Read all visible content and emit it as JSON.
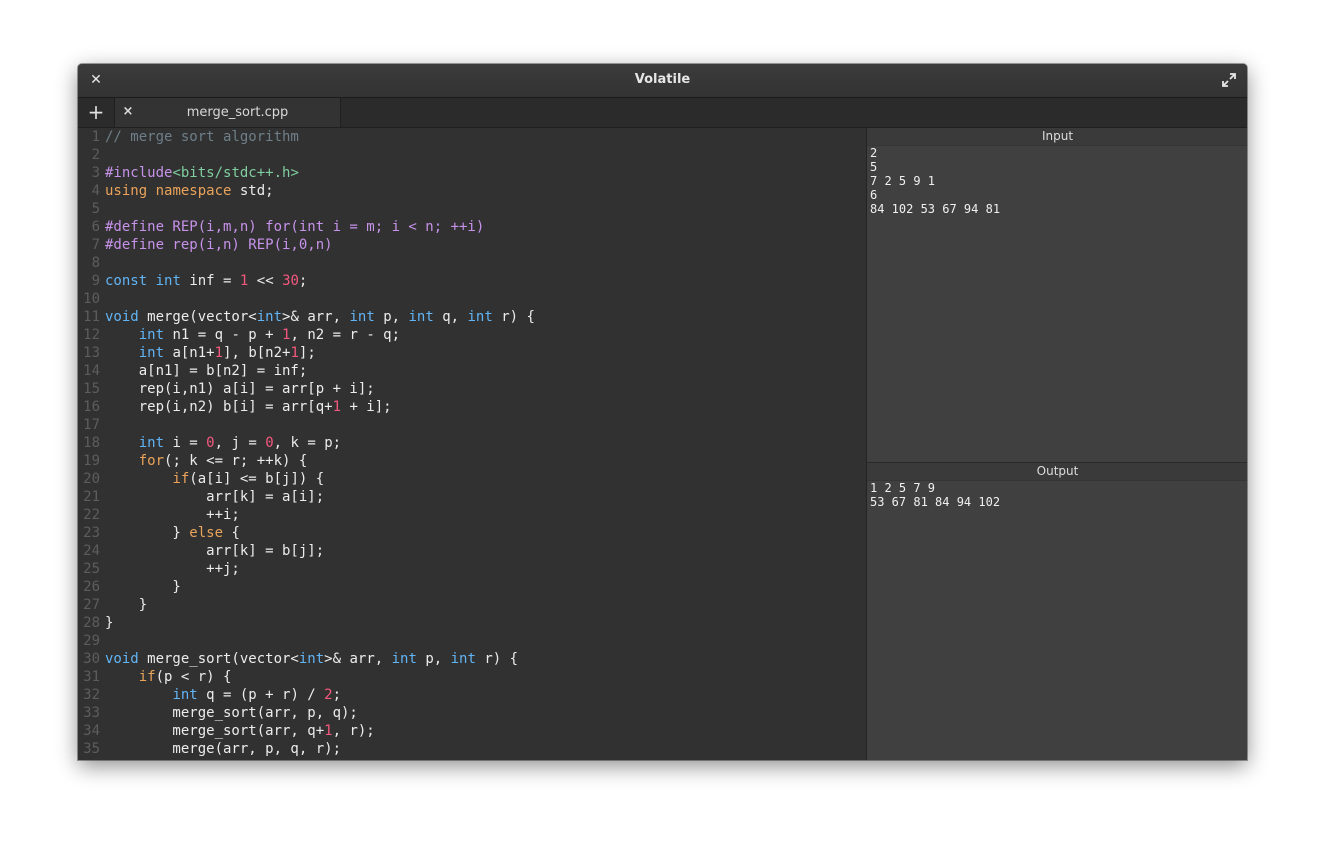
{
  "window": {
    "title": "Volatile"
  },
  "tabbar": {
    "new_tab_symbol": "+",
    "tabs": [
      {
        "label": "merge_sort.cpp",
        "close_symbol": "×"
      }
    ]
  },
  "editor": {
    "lines": [
      [
        [
          "// merge sort algorithm",
          "com"
        ]
      ],
      [],
      [
        [
          "#include",
          "pre"
        ],
        [
          "<bits/stdc++.h>",
          "str"
        ]
      ],
      [
        [
          "using",
          "kw"
        ],
        [
          " ",
          ""
        ],
        [
          "namespace",
          "kw"
        ],
        [
          " std;",
          ""
        ]
      ],
      [],
      [
        [
          "#define REP(i,m,n) for(int i = m; i < n; ++i)",
          "pre"
        ]
      ],
      [
        [
          "#define rep(i,n) REP(i,0,n)",
          "pre"
        ]
      ],
      [],
      [
        [
          "const",
          "type"
        ],
        [
          " ",
          ""
        ],
        [
          "int",
          "type"
        ],
        [
          " inf = ",
          ""
        ],
        [
          "1",
          "num"
        ],
        [
          " << ",
          ""
        ],
        [
          "30",
          "num"
        ],
        [
          ";",
          ""
        ]
      ],
      [],
      [
        [
          "void",
          "type"
        ],
        [
          " merge(vector<",
          ""
        ],
        [
          "int",
          "type"
        ],
        [
          ">& arr, ",
          ""
        ],
        [
          "int",
          "type"
        ],
        [
          " p, ",
          ""
        ],
        [
          "int",
          "type"
        ],
        [
          " q, ",
          ""
        ],
        [
          "int",
          "type"
        ],
        [
          " r) {",
          ""
        ]
      ],
      [
        [
          "    ",
          ""
        ],
        [
          "int",
          "type"
        ],
        [
          " n1 = q - p + ",
          ""
        ],
        [
          "1",
          "num"
        ],
        [
          ", n2 = r - q;",
          ""
        ]
      ],
      [
        [
          "    ",
          ""
        ],
        [
          "int",
          "type"
        ],
        [
          " a[n1+",
          ""
        ],
        [
          "1",
          "num"
        ],
        [
          "], b[n2+",
          ""
        ],
        [
          "1",
          "num"
        ],
        [
          "];",
          ""
        ]
      ],
      [
        [
          "    a[n1] = b[n2] = inf;",
          ""
        ]
      ],
      [
        [
          "    rep(i,n1) a[i] = arr[p + i];",
          ""
        ]
      ],
      [
        [
          "    rep(i,n2) b[i] = arr[q+",
          ""
        ],
        [
          "1",
          "num"
        ],
        [
          " + i];",
          ""
        ]
      ],
      [],
      [
        [
          "    ",
          ""
        ],
        [
          "int",
          "type"
        ],
        [
          " i = ",
          ""
        ],
        [
          "0",
          "num"
        ],
        [
          ", j = ",
          ""
        ],
        [
          "0",
          "num"
        ],
        [
          ", k = p;",
          ""
        ]
      ],
      [
        [
          "    ",
          ""
        ],
        [
          "for",
          "kw"
        ],
        [
          "(; k <= r; ++k) {",
          ""
        ]
      ],
      [
        [
          "        ",
          ""
        ],
        [
          "if",
          "kw"
        ],
        [
          "(a[i] <= b[j]) {",
          ""
        ]
      ],
      [
        [
          "            arr[k] = a[i];",
          ""
        ]
      ],
      [
        [
          "            ++i;",
          ""
        ]
      ],
      [
        [
          "        } ",
          ""
        ],
        [
          "else",
          "kw"
        ],
        [
          " {",
          ""
        ]
      ],
      [
        [
          "            arr[k] = b[j];",
          ""
        ]
      ],
      [
        [
          "            ++j;",
          ""
        ]
      ],
      [
        [
          "        }",
          ""
        ]
      ],
      [
        [
          "    }",
          ""
        ]
      ],
      [
        [
          "}",
          ""
        ]
      ],
      [],
      [
        [
          "void",
          "type"
        ],
        [
          " merge_sort(vector<",
          ""
        ],
        [
          "int",
          "type"
        ],
        [
          ">& arr, ",
          ""
        ],
        [
          "int",
          "type"
        ],
        [
          " p, ",
          ""
        ],
        [
          "int",
          "type"
        ],
        [
          " r) {",
          ""
        ]
      ],
      [
        [
          "    ",
          ""
        ],
        [
          "if",
          "kw"
        ],
        [
          "(p < r) {",
          ""
        ]
      ],
      [
        [
          "        ",
          ""
        ],
        [
          "int",
          "type"
        ],
        [
          " q = (p + r) / ",
          ""
        ],
        [
          "2",
          "num"
        ],
        [
          ";",
          ""
        ]
      ],
      [
        [
          "        merge_sort(arr, p, q);",
          ""
        ]
      ],
      [
        [
          "        merge_sort(arr, q+",
          ""
        ],
        [
          "1",
          "num"
        ],
        [
          ", r);",
          ""
        ]
      ],
      [
        [
          "        merge(arr, p, q, r);",
          ""
        ]
      ]
    ]
  },
  "input_panel": {
    "header": "Input",
    "lines": [
      "2",
      "5",
      "7 2 5 9 1",
      "6",
      "84 102 53 67 94 81"
    ]
  },
  "output_panel": {
    "header": "Output",
    "lines": [
      "1 2 5 7 9",
      "53 67 81 84 94 102"
    ]
  },
  "colors": {
    "comment": "#6f7f89",
    "preprocessor": "#c792ea",
    "include_string": "#7fcf9f",
    "keyword": "#eaa35a",
    "type": "#62b4f5",
    "number": "#f5587e",
    "code_text": "#ececec",
    "line_number": "#5d5d5d",
    "editor_bg": "#313131",
    "panel_bg": "#404040"
  }
}
